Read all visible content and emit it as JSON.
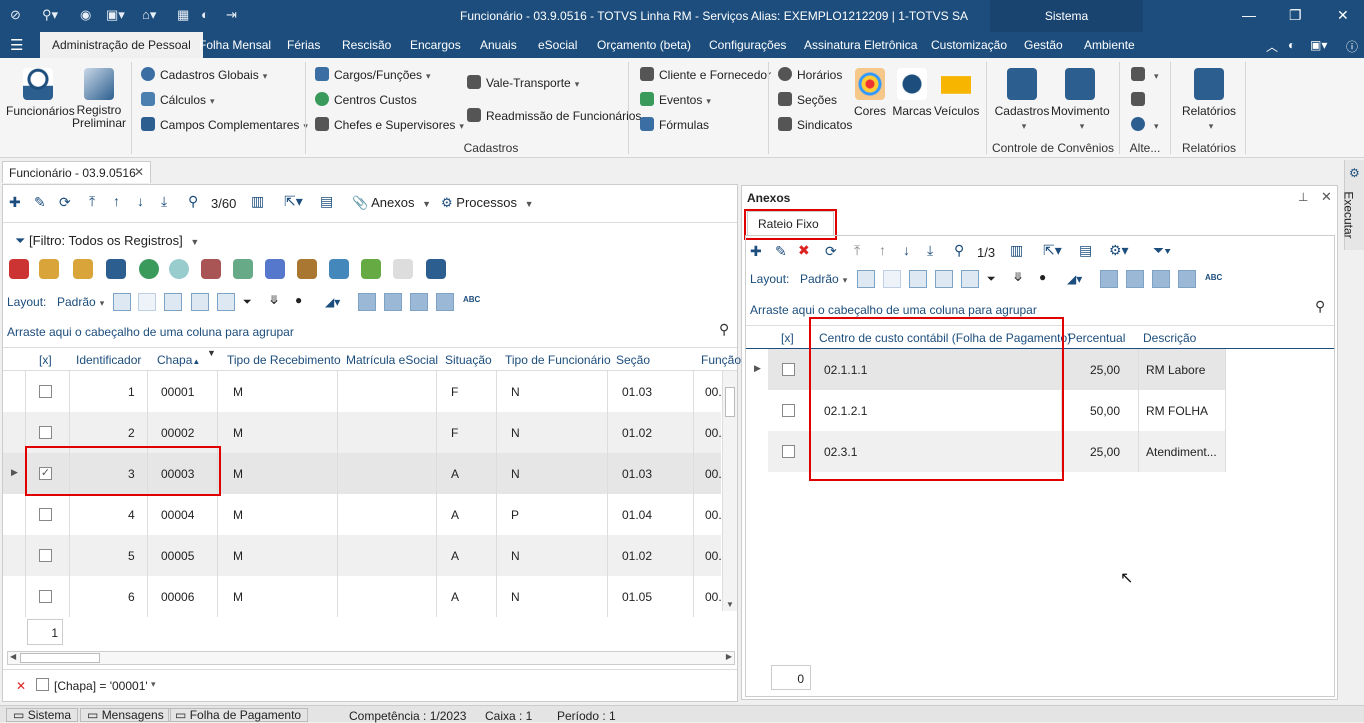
{
  "window": {
    "title": "Funcionário - 03.9.0516 - TOTVS Linha RM - Serviços  Alias: EXEMPLO1212209 | 1-TOTVS SA",
    "system_label": "Sistema"
  },
  "menu": [
    "Administração de Pessoal",
    "Folha Mensal",
    "Férias",
    "Rescisão",
    "Encargos",
    "Anuais",
    "eSocial",
    "Orçamento (beta)",
    "Configurações",
    "Assinatura Eletrônica",
    "Customização",
    "Gestão",
    "Ambiente"
  ],
  "ribbon": {
    "funcionarios": "Funcionários",
    "registro_preliminar_1": "Registro",
    "registro_preliminar_2": "Preliminar",
    "cadastros_globais": "Cadastros Globais",
    "calculos": "Cálculos",
    "campos_complementares": "Campos Complementares",
    "cargos_funcoes": "Cargos/Funções",
    "centros_custos": "Centros Custos",
    "chefes_supervisores": "Chefes e Supervisores",
    "vale_transporte": "Vale-Transporte",
    "readmissao": "Readmissão de Funcionários",
    "cliente_fornecedor": "Cliente e Fornecedor",
    "eventos": "Eventos",
    "formulas": "Fórmulas",
    "horarios": "Horários",
    "secoes": "Seções",
    "sindicatos": "Sindicatos",
    "cores": "Cores",
    "marcas": "Marcas",
    "veiculos": "Veículos",
    "cadastros": "Cadastros",
    "movimento": "Movimento",
    "relatorios": "Relatórios",
    "group_cadastros": "Cadastros",
    "group_convenios": "Controle de Convênios",
    "group_alte": "Alte...",
    "group_relatorios": "Relatórios"
  },
  "doc_tab": "Funcionário - 03.9.0516",
  "left": {
    "record_counter": "3/60",
    "anexos": "Anexos",
    "processos": "Processos",
    "filter": "[Filtro: Todos os Registros]",
    "layout_label": "Layout:",
    "layout_value": "Padrão",
    "group_hint": "Arraste aqui o cabeçalho de uma coluna para agrupar",
    "columns": [
      "[x]",
      "Identificador",
      "Chapa",
      "Tipo de Recebimento",
      "Matrícula eSocial",
      "Situação",
      "Tipo de Funcionário",
      "Seção",
      "Função"
    ],
    "rows": [
      {
        "id": "1",
        "chapa": "00001",
        "tipo": "M",
        "situacao": "F",
        "tipo_func": "N",
        "secao": "01.03",
        "funcao": "00."
      },
      {
        "id": "2",
        "chapa": "00002",
        "tipo": "M",
        "situacao": "F",
        "tipo_func": "N",
        "secao": "01.02",
        "funcao": "00."
      },
      {
        "id": "3",
        "chapa": "00003",
        "tipo": "M",
        "situacao": "A",
        "tipo_func": "N",
        "secao": "01.03",
        "funcao": "00."
      },
      {
        "id": "4",
        "chapa": "00004",
        "tipo": "M",
        "situacao": "A",
        "tipo_func": "P",
        "secao": "01.04",
        "funcao": "00."
      },
      {
        "id": "5",
        "chapa": "00005",
        "tipo": "M",
        "situacao": "A",
        "tipo_func": "N",
        "secao": "01.02",
        "funcao": "00."
      },
      {
        "id": "6",
        "chapa": "00006",
        "tipo": "M",
        "situacao": "A",
        "tipo_func": "N",
        "secao": "01.05",
        "funcao": "00."
      }
    ],
    "footer_count": "1",
    "filter_expr": "[Chapa] = '00001'"
  },
  "right": {
    "title": "Anexos",
    "tab": "Rateio Fixo",
    "record_counter": "1/3",
    "layout_label": "Layout:",
    "layout_value": "Padrão",
    "group_hint": "Arraste aqui o cabeçalho de uma coluna para agrupar",
    "columns": [
      "[x]",
      "Centro de custo contábil (Folha de Pagamento)",
      "Percentual",
      "Descrição"
    ],
    "rows": [
      {
        "centro": "02.1.1.1",
        "percentual": "25,00",
        "descricao": "RM Labore"
      },
      {
        "centro": "02.1.2.1",
        "percentual": "50,00",
        "descricao": "RM FOLHA"
      },
      {
        "centro": "02.3.1",
        "percentual": "25,00",
        "descricao": "Atendiment..."
      }
    ],
    "footer_count": "0"
  },
  "executar": "Executar",
  "status": {
    "sistema": "Sistema",
    "mensagens": "Mensagens",
    "folha": "Folha de Pagamento",
    "competencia": "Competência : 1/2023",
    "caixa": "Caixa : 1",
    "periodo": "Período : 1"
  }
}
